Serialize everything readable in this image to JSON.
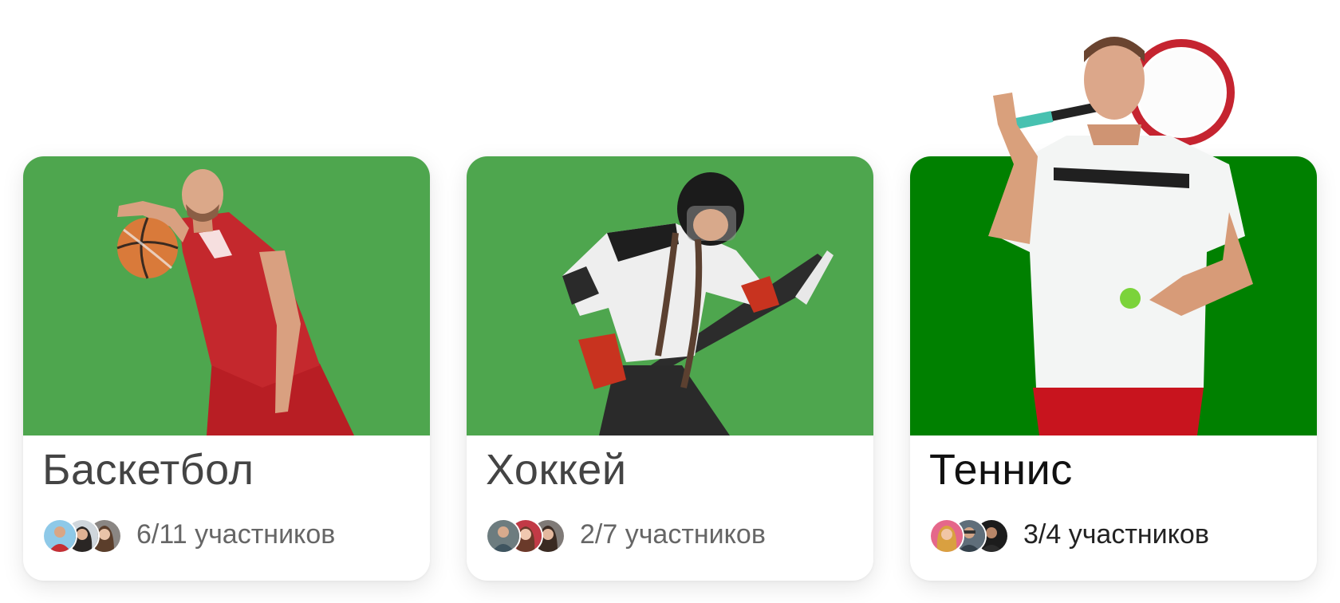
{
  "cards": [
    {
      "title": "Баскетбол",
      "participants": "6/11 участников",
      "banner_color": "#4ea64e",
      "illustration": "basketball-player",
      "avatars": [
        "avatar-man-red-shirt",
        "avatar-woman-dark-hair",
        "avatar-woman-long-hair"
      ]
    },
    {
      "title": "Хоккей",
      "participants": "2/7 участников",
      "banner_color": "#4ea64e",
      "illustration": "hockey-player",
      "avatars": [
        "avatar-man-beard",
        "avatar-woman-red-top",
        "avatar-woman-dark-hair"
      ]
    },
    {
      "title": "Теннис",
      "participants": "3/4 участников",
      "banner_color": "#008000",
      "illustration": "tennis-player",
      "avatars": [
        "avatar-woman-blonde",
        "avatar-man-glasses",
        "avatar-man-dark"
      ]
    }
  ]
}
